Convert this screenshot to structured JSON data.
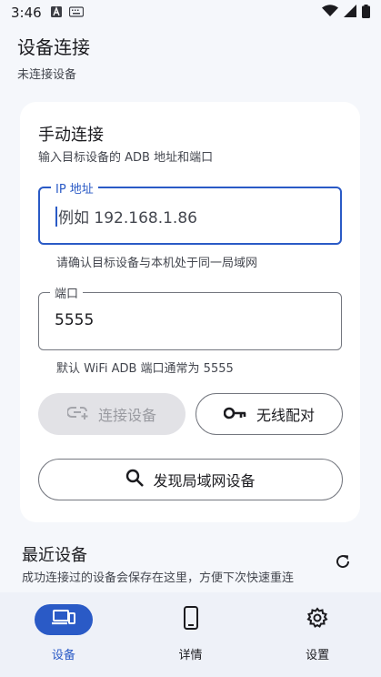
{
  "status_bar": {
    "time": "3:46"
  },
  "header": {
    "title": "设备连接",
    "subtitle": "未连接设备"
  },
  "manual": {
    "title": "手动连接",
    "description": "输入目标设备的 ADB 地址和端口",
    "ip_field": {
      "label": "IP 地址",
      "placeholder": "例如 192.168.1.86",
      "helper": "请确认目标设备与本机处于同一局域网"
    },
    "port_field": {
      "label": "端口",
      "value": "5555",
      "helper": "默认 WiFi ADB 端口通常为 5555"
    },
    "connect_button": "连接设备",
    "pair_button": "无线配对",
    "discover_button": "发现局域网设备"
  },
  "recent": {
    "title": "最近设备",
    "description": "成功连接过的设备会保存在这里，方便下次快速重连"
  },
  "nav": {
    "devices": "设备",
    "details": "详情",
    "settings": "设置"
  },
  "colors": {
    "accent": "#2a5ac6",
    "background": "#f5f7fb",
    "nav_background": "#eef1f8"
  }
}
